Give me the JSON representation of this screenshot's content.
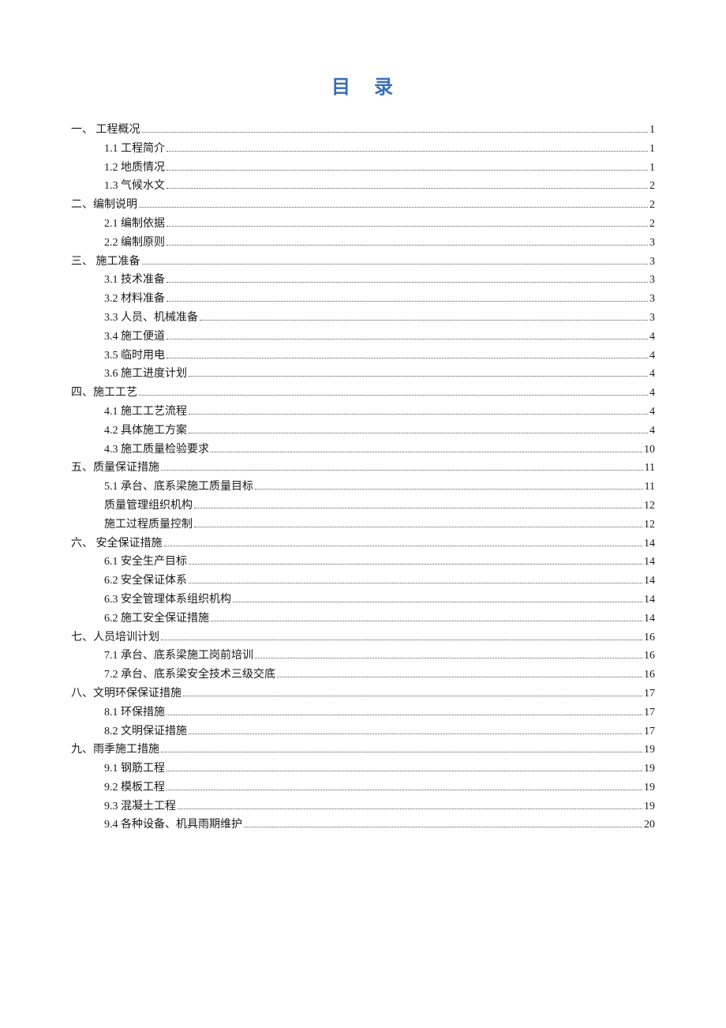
{
  "title": "目 录",
  "toc": [
    {
      "level": 1,
      "label": "一、 工程概况",
      "page": "1"
    },
    {
      "level": 2,
      "label": "1.1 工程简介",
      "page": "1"
    },
    {
      "level": 2,
      "label": "1.2 地质情况",
      "page": "1"
    },
    {
      "level": 2,
      "label": "1.3 气候水文",
      "page": "2"
    },
    {
      "level": 1,
      "label": "二、编制说明",
      "page": "2"
    },
    {
      "level": 2,
      "label": "2.1 编制依据",
      "page": "2"
    },
    {
      "level": 2,
      "label": "2.2 编制原则",
      "page": "3"
    },
    {
      "level": 1,
      "label": "三、 施工准备",
      "page": "3"
    },
    {
      "level": 2,
      "label": "3.1 技术准备",
      "page": "3"
    },
    {
      "level": 2,
      "label": "3.2 材料准备",
      "page": "3"
    },
    {
      "level": 2,
      "label": "3.3 人员、机械准备",
      "page": "3"
    },
    {
      "level": 2,
      "label": "3.4 施工便道",
      "page": "4"
    },
    {
      "level": 2,
      "label": "3.5 临时用电",
      "page": "4"
    },
    {
      "level": 2,
      "label": "3.6 施工进度计划",
      "page": "4"
    },
    {
      "level": 1,
      "label": "四、施工工艺",
      "page": "4"
    },
    {
      "level": 2,
      "label": "4.1 施工工艺流程",
      "page": "4"
    },
    {
      "level": 2,
      "label": "4.2 具体施工方案",
      "page": "4"
    },
    {
      "level": 2,
      "label": "4.3 施工质量检验要求",
      "page": "10"
    },
    {
      "level": 1,
      "label": "五、质量保证措施",
      "page": "11"
    },
    {
      "level": 2,
      "label": "5.1 承台、底系梁施工质量目标",
      "page": "11"
    },
    {
      "level": 2,
      "label": " 质量管理组织机构",
      "page": "12"
    },
    {
      "level": 2,
      "label": " 施工过程质量控制",
      "page": "12"
    },
    {
      "level": 1,
      "label": "六、 安全保证措施",
      "page": "14"
    },
    {
      "level": 2,
      "label": "6.1 安全生产目标",
      "page": "14"
    },
    {
      "level": 2,
      "label": "6.2 安全保证体系",
      "page": "14"
    },
    {
      "level": 2,
      "label": "6.3 安全管理体系组织机构",
      "page": "14"
    },
    {
      "level": 2,
      "label": "6.2 施工安全保证措施",
      "page": "14"
    },
    {
      "level": 1,
      "label": "七、人员培训计划",
      "page": "16"
    },
    {
      "level": 2,
      "label": "7.1 承台、底系梁施工岗前培训",
      "page": "16"
    },
    {
      "level": 2,
      "label": "7.2 承台、底系梁安全技术三级交底",
      "page": "16"
    },
    {
      "level": 1,
      "label": "八、文明环保保证措施",
      "page": "17"
    },
    {
      "level": 2,
      "label": "8.1 环保措施",
      "page": "17"
    },
    {
      "level": 2,
      "label": "8.2 文明保证措施",
      "page": "17"
    },
    {
      "level": 1,
      "label": "九、雨季施工措施",
      "page": "19"
    },
    {
      "level": 2,
      "label": "9.1 钢筋工程",
      "page": "19"
    },
    {
      "level": 2,
      "label": "9.2 模板工程",
      "page": "19"
    },
    {
      "level": 2,
      "label": "9.3 混凝土工程",
      "page": "19"
    },
    {
      "level": 2,
      "label": "9.4 各种设备、机具雨期维护",
      "page": "20"
    }
  ]
}
